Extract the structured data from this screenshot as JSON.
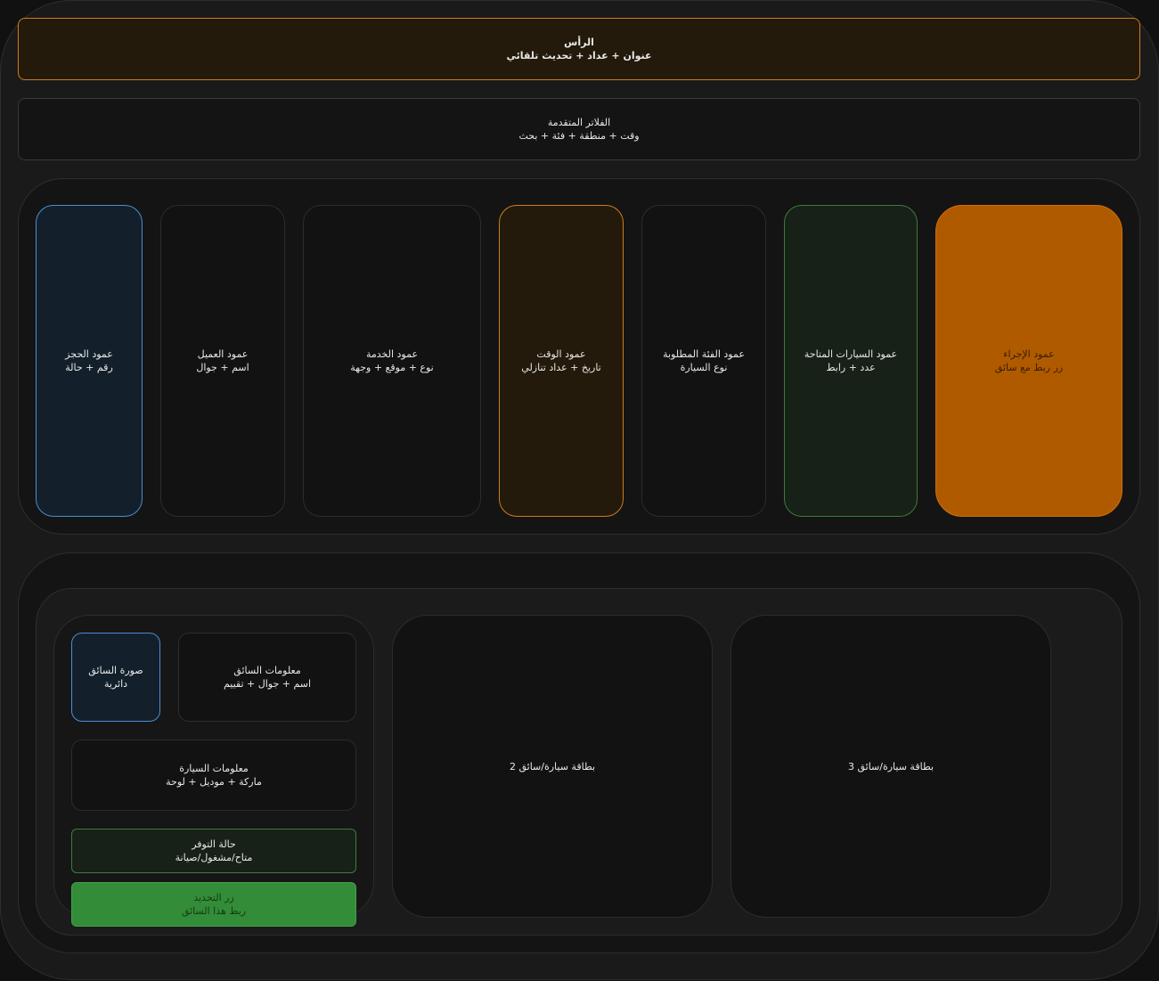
{
  "header": {
    "title": "الرأس",
    "subtitle": "عنوان + عداد + تحديث تلقائي"
  },
  "filters": {
    "title": "الفلاتر المتقدمة",
    "subtitle": "وقت + منطقة + فئة + بحث"
  },
  "columns": {
    "booking": {
      "title": "عمود الحجز",
      "subtitle": "رقم + حالة"
    },
    "customer": {
      "title": "عمود العميل",
      "subtitle": "اسم + جوال"
    },
    "service": {
      "title": "عمود الخدمة",
      "subtitle": "نوع + موقع + وجهة"
    },
    "time": {
      "title": "عمود الوقت",
      "subtitle": "تاريخ + عداد تنازلي"
    },
    "category": {
      "title": "عمود الفئة المطلوبة",
      "subtitle": "نوع السيارة"
    },
    "cars": {
      "title": "عمود السيارات المتاحة",
      "subtitle": "عدد + رابط"
    },
    "action": {
      "title": "عمود الإجراء",
      "subtitle": "زر ربط مع سائق"
    }
  },
  "card1": {
    "driver_photo": {
      "title": "صورة السائق",
      "subtitle": "دائرية"
    },
    "driver_info": {
      "title": "معلومات السائق",
      "subtitle": "اسم + جوال + تقييم"
    },
    "car_info": {
      "title": "معلومات السيارة",
      "subtitle": "ماركة + موديل + لوحة"
    },
    "availability": {
      "title": "حالة التوفر",
      "subtitle": "متاح/مشغول/صيانة"
    },
    "assign_button": {
      "title": "زر التحديد",
      "subtitle": "ربط هذا السائق"
    }
  },
  "card2": {
    "label": "بطاقة سيارة/سائق 2"
  },
  "card3": {
    "label": "بطاقة سيارة/سائق 3"
  },
  "colors": {
    "background": "#111111",
    "orange_accent": "#d07a1e",
    "action_fill": "#b05a00",
    "blue_accent": "#4a8ed0",
    "green_accent": "#3c7c3c",
    "button_green": "#338c38"
  }
}
